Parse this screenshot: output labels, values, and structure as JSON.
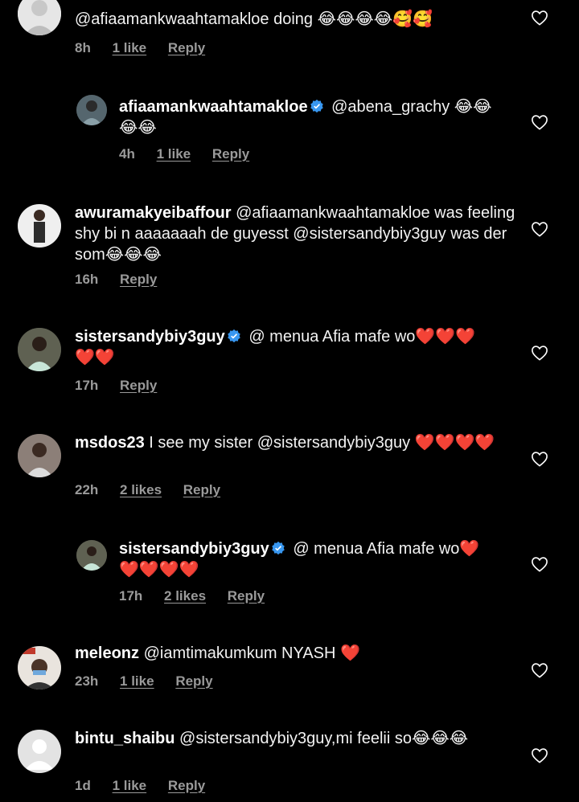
{
  "comments": [
    {
      "username": "",
      "verified": false,
      "text": "@afiaamankwaahtamakloe doing 😂😂😂😂🥰🥰",
      "time": "8h",
      "likes": "1 like",
      "reply": "Reply",
      "avatar_color": "#d9d9d9"
    },
    {
      "username": "afiaamankwaahtamakloe",
      "verified": true,
      "text": "@abena_grachy 😂😂😂😂",
      "time": "4h",
      "likes": "1 like",
      "reply": "Reply",
      "avatar_color": "#4a5f6b"
    },
    {
      "username": "awuramakyeibaffour",
      "verified": false,
      "text": "@afiaamankwaahtamakloe was feeling shy bi  n aaaaaaah de guyesst @sistersandybiy3guy was der som😂😂😂",
      "time": "16h",
      "likes": "",
      "reply": "Reply",
      "avatar_color": "#e8e8e8"
    },
    {
      "username": "sistersandybiy3guy",
      "verified": true,
      "text": "@ menua Afia mafe wo❤️❤️❤️❤️❤️",
      "time": "17h",
      "likes": "",
      "reply": "Reply",
      "avatar_color": "#6b6b5a"
    },
    {
      "username": "msdos23",
      "verified": false,
      "text": "I see my sister @sistersandybiy3guy ❤️❤️❤️❤️",
      "time": "22h",
      "likes": "2 likes",
      "reply": "Reply",
      "avatar_color": "#8a7a70"
    },
    {
      "username": "sistersandybiy3guy",
      "verified": true,
      "text": "@ menua Afia mafe wo❤️❤️❤️❤️❤️",
      "time": "17h",
      "likes": "2 likes",
      "reply": "Reply",
      "avatar_color": "#6b6b5a"
    },
    {
      "username": "meleonz",
      "verified": false,
      "text": "@iamtimakumkum NYASH ❤️",
      "time": "23h",
      "likes": "1 like",
      "reply": "Reply",
      "avatar_color": "#b8a89a"
    },
    {
      "username": "bintu_shaibu",
      "verified": false,
      "text": "@sistersandybiy3guy,mi feelii so😂😂😂",
      "time": "1d",
      "likes": "1 like",
      "reply": "Reply",
      "avatar_color": "#e0e0e0"
    }
  ],
  "colors": {
    "background": "#000000",
    "text": "#ffffff",
    "meta": "#9a9a9a",
    "verified": "#3897f0"
  },
  "icons": {
    "like": "heart-outline-icon",
    "verified": "verified-badge-icon"
  }
}
